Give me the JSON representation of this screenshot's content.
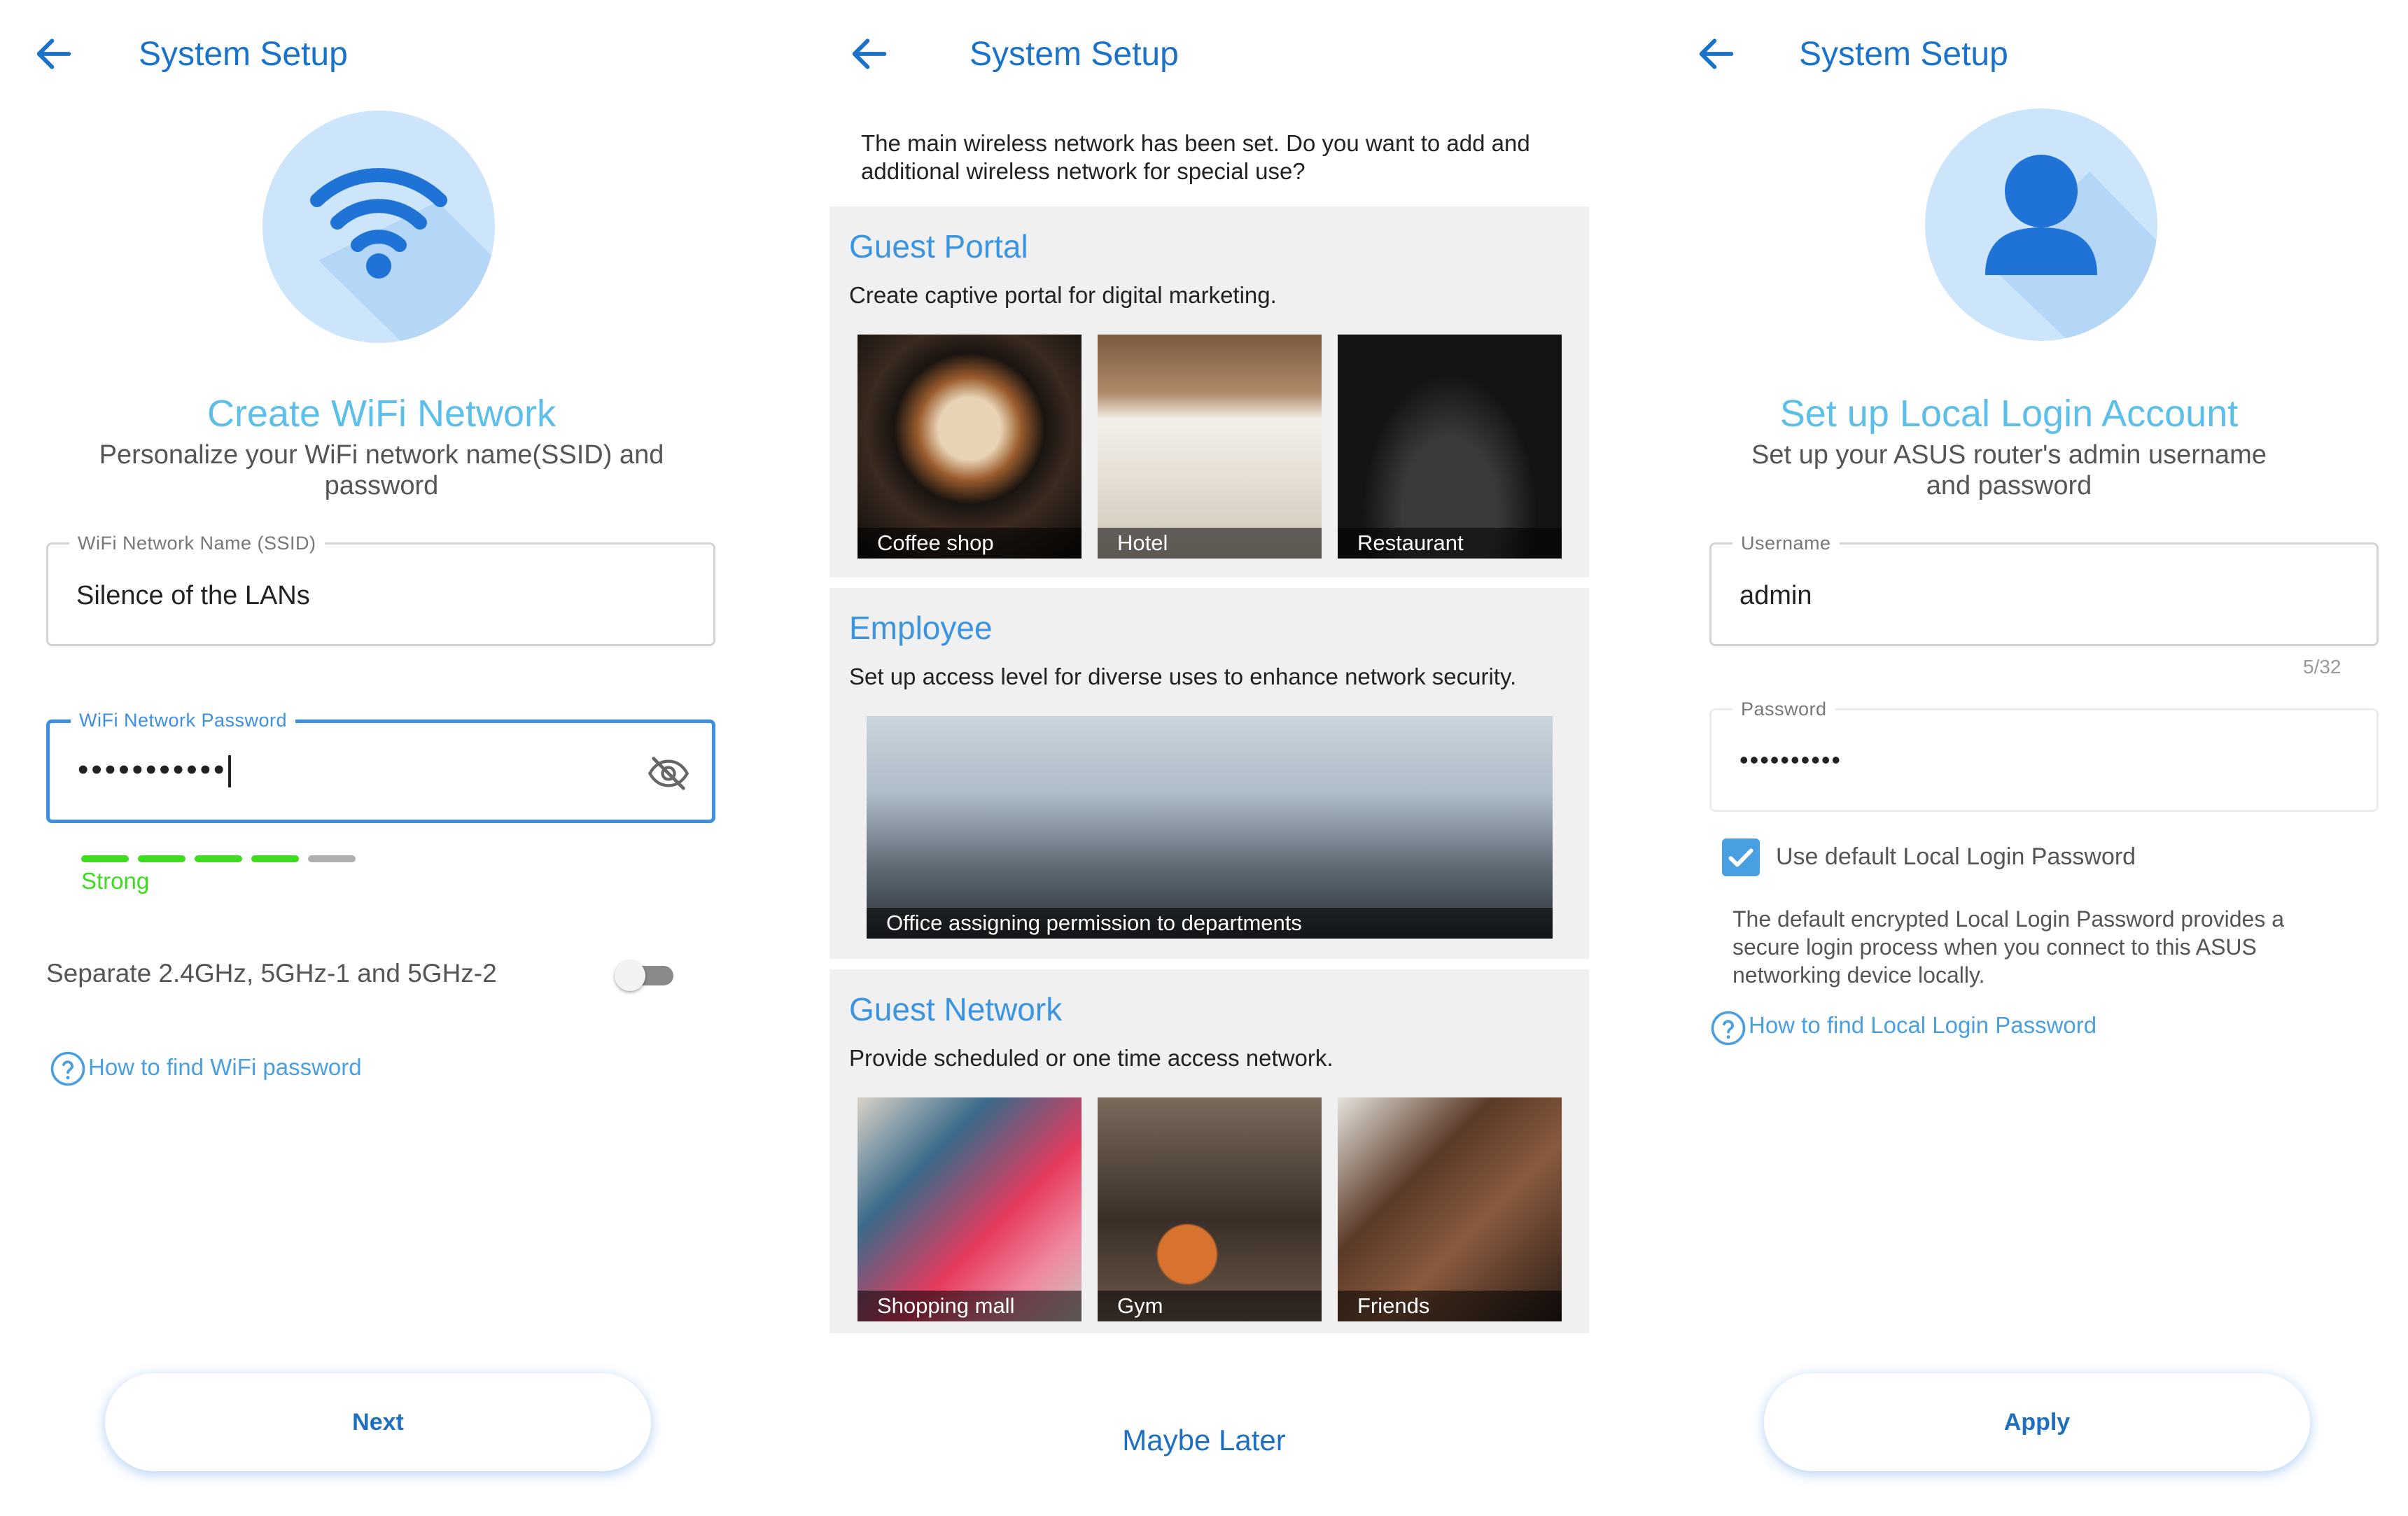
{
  "screen1": {
    "header_title": "System Setup",
    "title": "Create WiFi Network",
    "subtitle": "Personalize your WiFi network name(SSID) and password",
    "ssid_label": "WiFi Network Name (SSID)",
    "ssid_value": "Silence of the LANs",
    "password_label": "WiFi Network Password",
    "password_value": "•••••••••••",
    "strength_label": "Strength",
    "strength_text": "Strong",
    "strength_level": 0.8,
    "strength_color": "#3ddc1f",
    "separate_label": "Separate 2.4GHz, 5GHz-1 and 5GHz-2",
    "separate_toggle_on": false,
    "help_link": "How to find WiFi password",
    "next_button": "Next"
  },
  "screen2": {
    "header_title": "System Setup",
    "intro": "The main wireless network has been set. Do you want to add and additional wireless network for special use?",
    "cards": [
      {
        "title": "Guest Portal",
        "description": "Create captive portal for digital marketing.",
        "tiles": [
          "Coffee shop",
          "Hotel",
          "Restaurant"
        ]
      },
      {
        "title": "Employee",
        "description": "Set up access level for diverse uses to enhance network security.",
        "tiles": [
          "Office assigning permission to departments"
        ]
      },
      {
        "title": "Guest Network",
        "description": "Provide scheduled or one time access network.",
        "tiles": [
          "Shopping mall",
          "Gym",
          "Friends"
        ]
      }
    ],
    "maybe_later": "Maybe Later"
  },
  "screen3": {
    "header_title": "System Setup",
    "title": "Set up Local Login Account",
    "subtitle": "Set up your ASUS router's admin username and password",
    "username_label": "Username",
    "username_value": "admin",
    "username_counter": "5/32",
    "password_label": "Password",
    "password_value": "••••••••••",
    "checkbox_label": "Use default Local Login Password",
    "checkbox_checked": true,
    "info_text": "The default encrypted Local Login Password provides a secure login process when you connect to this ASUS networking device locally.",
    "help_link": "How to find Local Login Password",
    "apply_button": "Apply"
  },
  "colors": {
    "primary": "#1a73c9",
    "title_light_blue": "#5bbfe9",
    "card_title": "#3b94e0",
    "hero_bg": "#cde5fb",
    "focus_border": "#3d8fe0",
    "checkbox": "#4a9fe0"
  },
  "icons": {
    "back": "arrow-left-icon",
    "wifi": "wifi-icon",
    "user": "user-icon",
    "visibility": "eye-off-icon",
    "help": "question-circle-icon",
    "check": "check-icon"
  }
}
